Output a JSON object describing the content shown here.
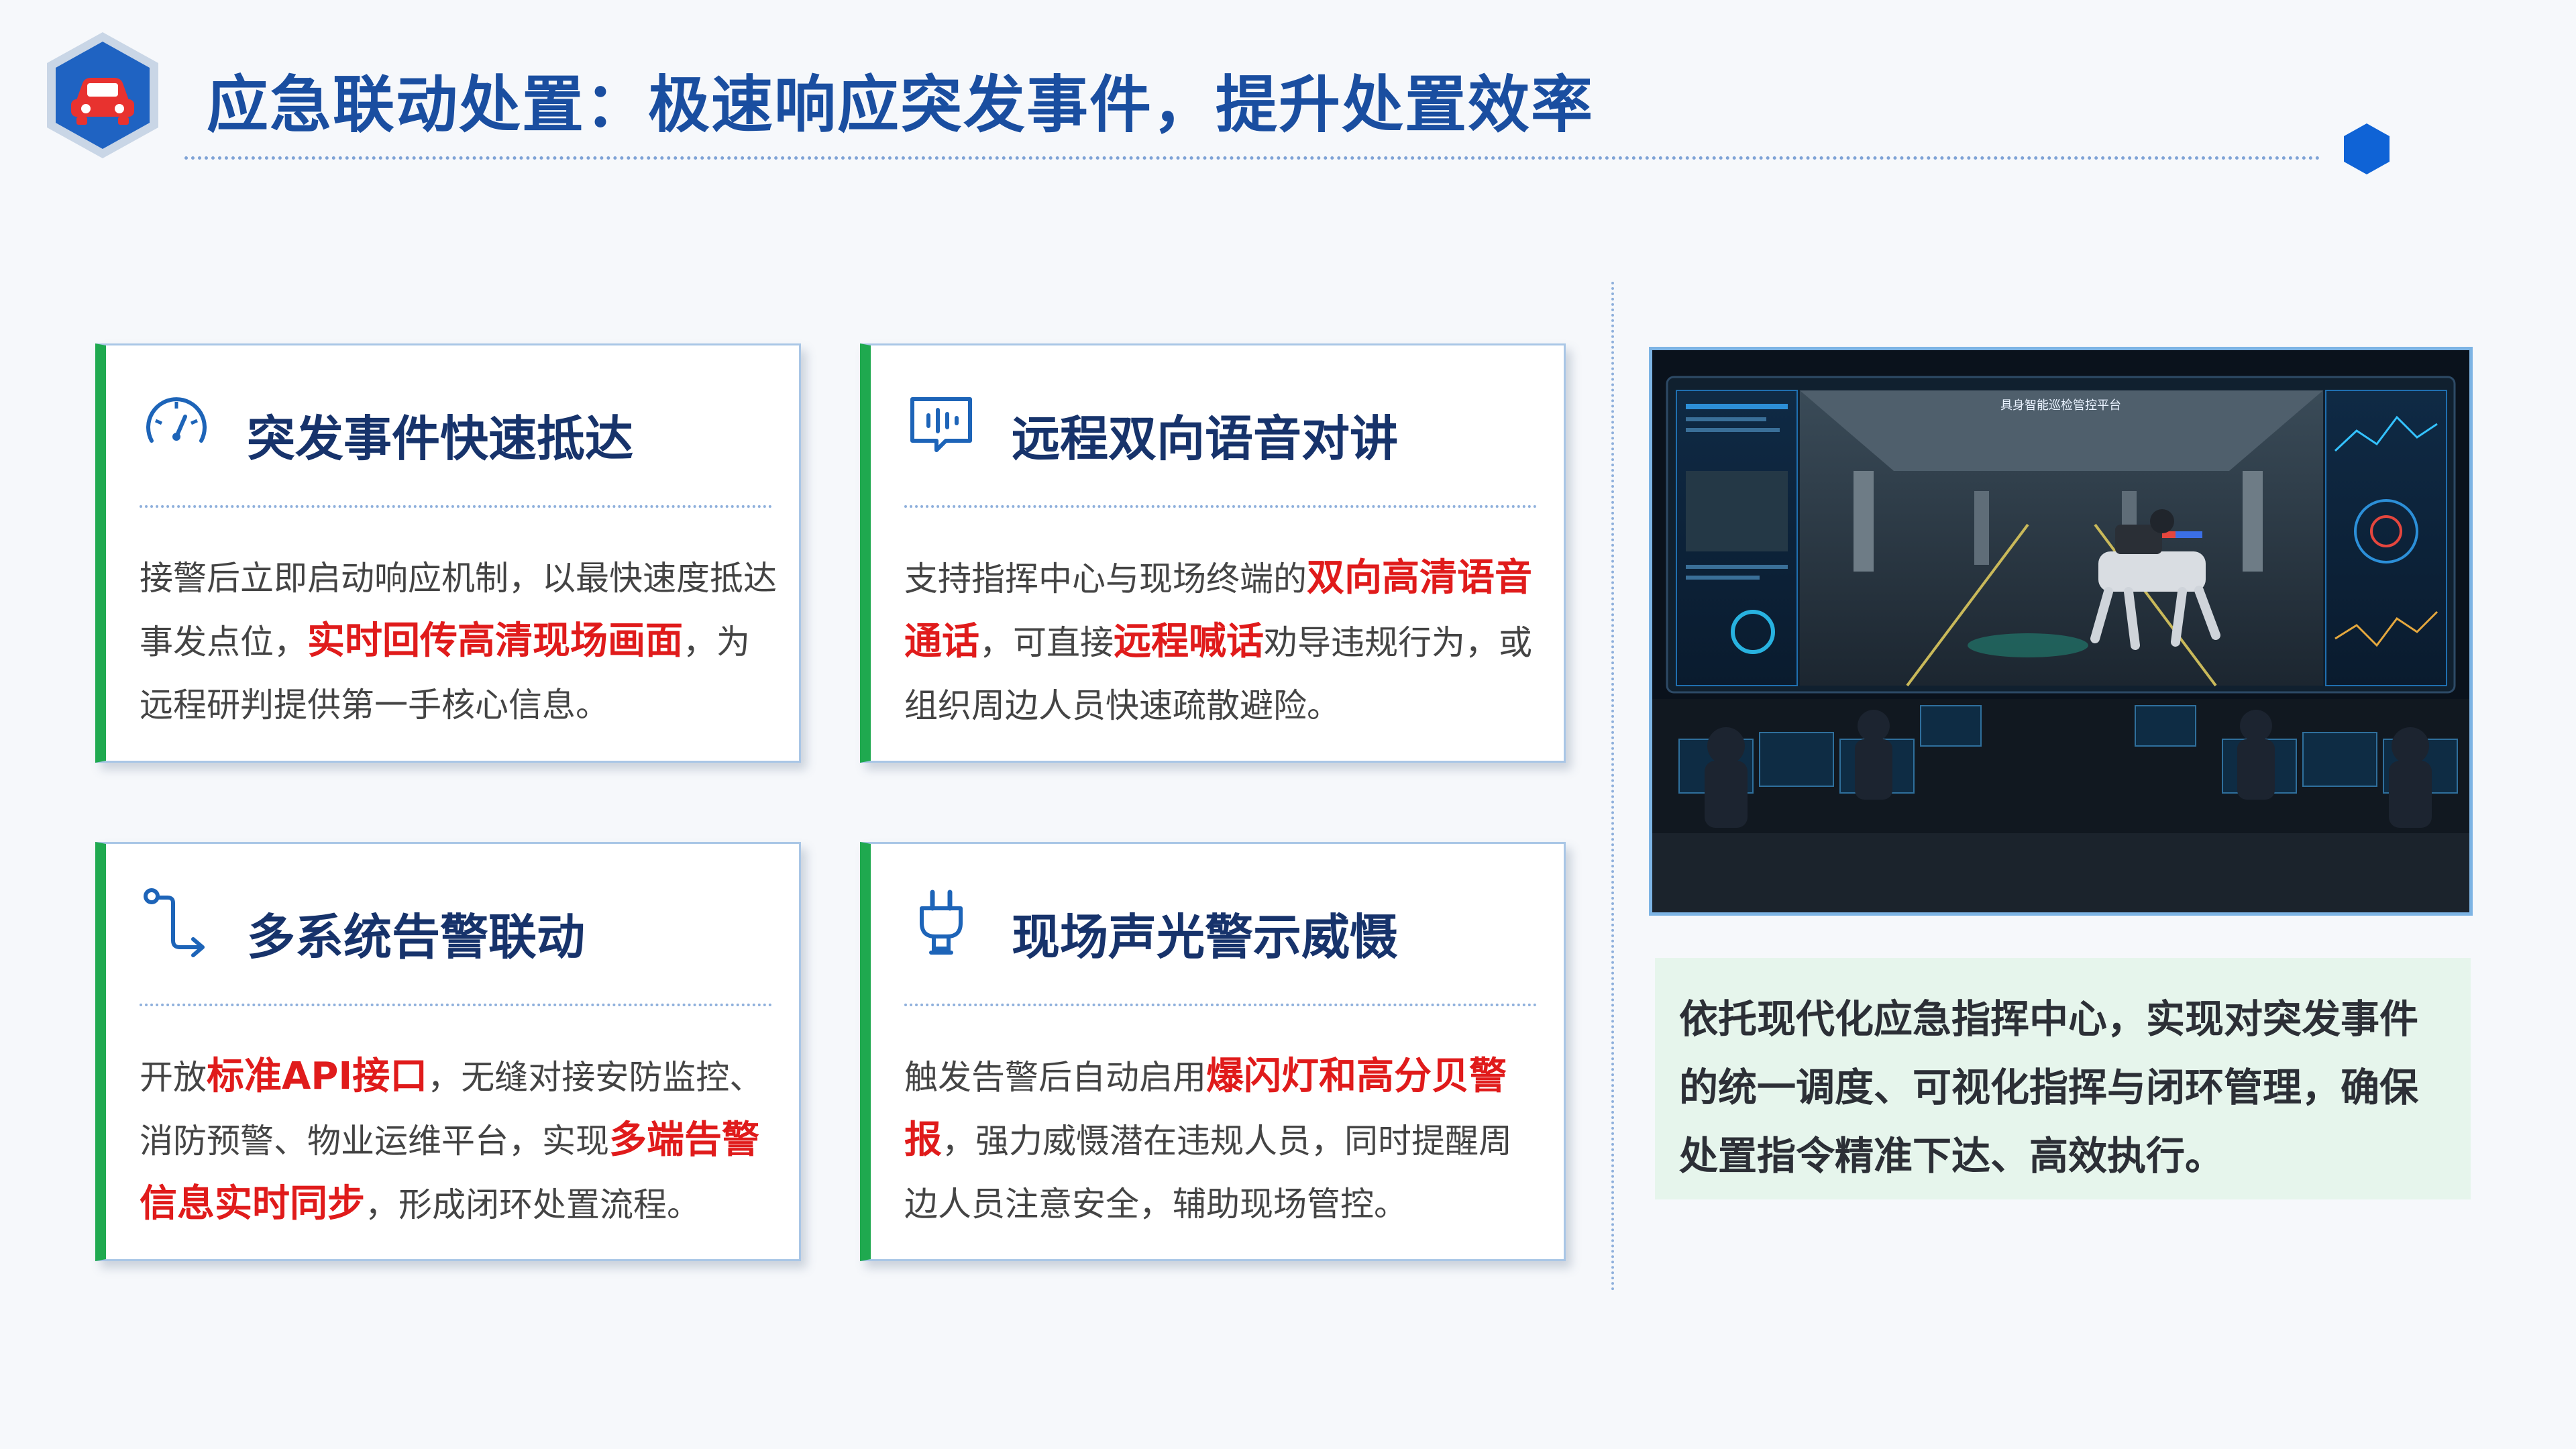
{
  "header": {
    "title": "应急联动处置：极速响应突发事件，提升处置效率",
    "logo_icon": "car-icon"
  },
  "colors": {
    "title_blue": "#1a4ea0",
    "card_title_navy": "#17336b",
    "highlight_red": "#e01b1b",
    "card_accent_green": "#1fa94f",
    "summary_bg": "#e6f5ec"
  },
  "cards": [
    {
      "icon": "speedometer-icon",
      "title": "突发事件快速抵达",
      "body_parts": [
        "接警后立即启动响应机制，以最快速度抵达事发点位，",
        "实时回传高清现场画面",
        "，为远程研判提供第一手核心信息。"
      ]
    },
    {
      "icon": "voice-chat-icon",
      "title": "远程双向语音对讲",
      "body_parts": [
        "支持指挥中心与现场终端的",
        "双向高清语音通话",
        "，可直接",
        "远程喊话",
        "劝导违规行为，或组织周边人员快速疏散避险。"
      ]
    },
    {
      "icon": "route-link-icon",
      "title": "多系统告警联动",
      "body_parts": [
        "开放",
        "标准API接口",
        "，无缝对接安防监控、消防预警、物业运维平台，实现",
        "多端告警信息实时同步",
        "，形成闭环处置流程。"
      ]
    },
    {
      "icon": "plug-icon",
      "title": "现场声光警示威慑",
      "body_parts": [
        "触发告警后自动启用",
        "爆闪灯和高分贝警报",
        "，强力威慑潜在违规人员，同时提醒周边人员注意安全，辅助现场管控。"
      ]
    }
  ],
  "photo": {
    "screen_title": "具身智能巡检管控平台",
    "subject_icon": "command-center-robot-dog-image"
  },
  "summary": {
    "text": "依托现代化应急指挥中心，实现对突发事件的统一调度、可视化指挥与闭环管理，确保处置指令精准下达、高效执行。"
  }
}
